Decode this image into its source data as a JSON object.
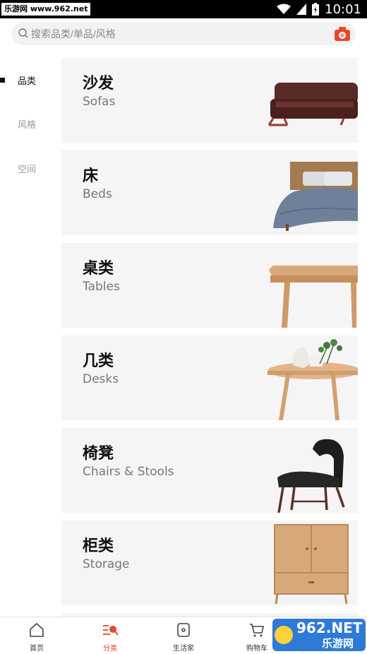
{
  "status_bar": {
    "watermark_text": "乐游网 www.962.net",
    "time": "10:01"
  },
  "search": {
    "placeholder": "搜索品类/单品/风格"
  },
  "sidebar": {
    "items": [
      {
        "label": "品类",
        "active": true
      },
      {
        "label": "风格",
        "active": false
      },
      {
        "label": "空间",
        "active": false
      }
    ]
  },
  "categories": [
    {
      "zh": "沙发",
      "en": "Sofas",
      "icon": "sofa-image"
    },
    {
      "zh": "床",
      "en": "Beds",
      "icon": "bed-image"
    },
    {
      "zh": "桌类",
      "en": "Tables",
      "icon": "table-image"
    },
    {
      "zh": "几类",
      "en": "Desks",
      "icon": "side-table-image"
    },
    {
      "zh": "椅凳",
      "en": "Chairs & Stools",
      "icon": "chair-image"
    },
    {
      "zh": "柜类",
      "en": "Storage",
      "icon": "cabinet-image"
    }
  ],
  "bottom_nav": {
    "tabs": [
      {
        "label": "首页",
        "icon": "home-icon",
        "active": false
      },
      {
        "label": "分类",
        "icon": "category-icon",
        "active": true
      },
      {
        "label": "生活家",
        "icon": "life-icon",
        "active": false
      },
      {
        "label": "购物车",
        "icon": "cart-icon",
        "active": false
      }
    ]
  },
  "watermark": {
    "brand": "962.NET",
    "sub": "乐游网"
  },
  "colors": {
    "accent": "#e8472b",
    "card_bg": "#f5f5f5",
    "search_bg": "#f2f2f2"
  }
}
